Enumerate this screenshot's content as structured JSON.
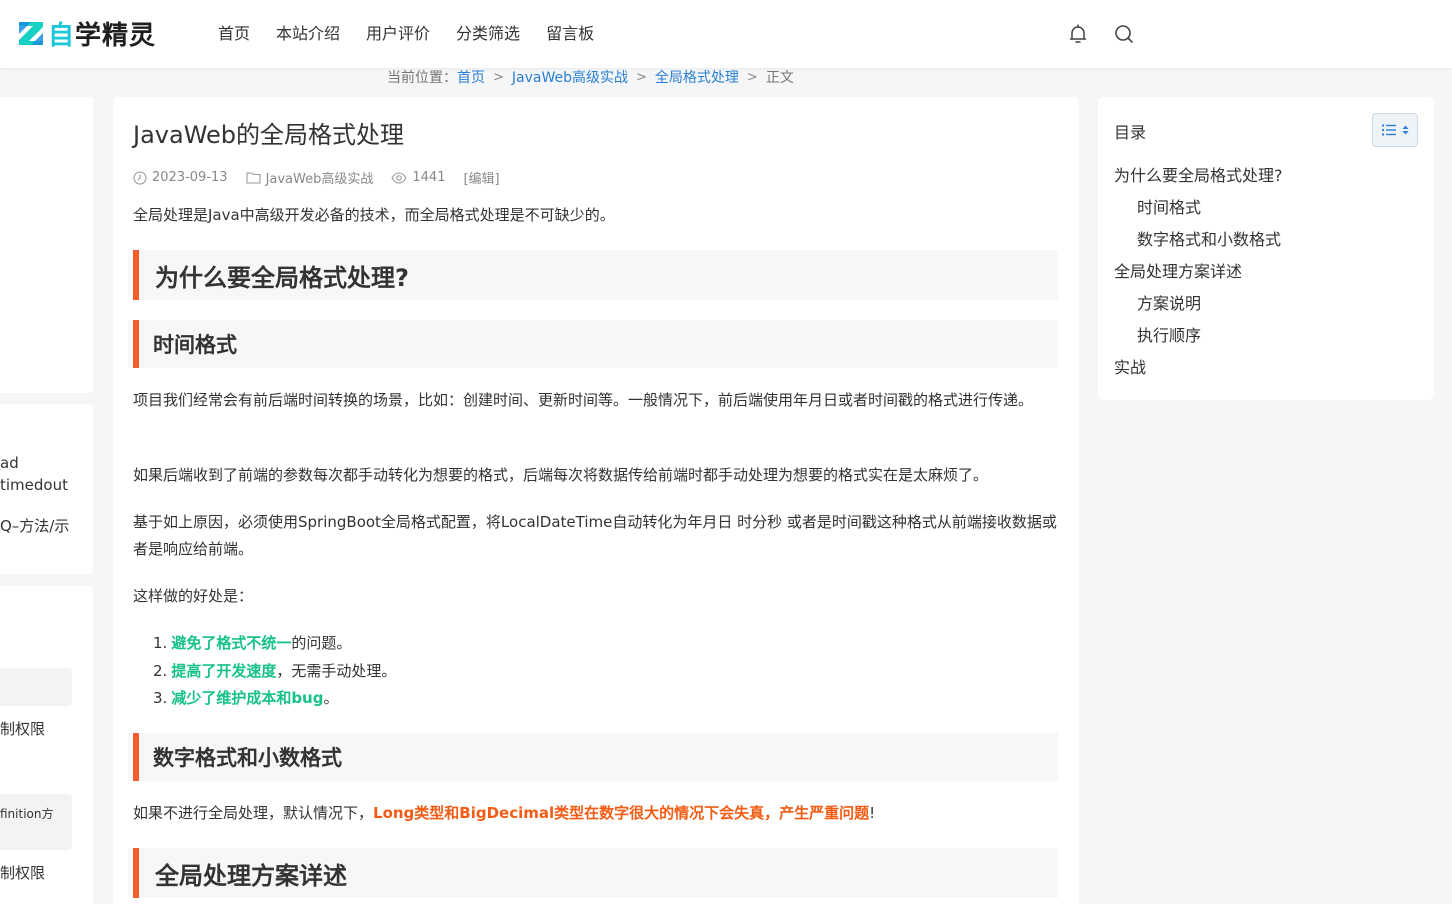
{
  "header": {
    "logo_first": "自",
    "logo_rest": "学精灵",
    "nav": [
      "首页",
      "本站介绍",
      "用户评价",
      "分类筛选",
      "留言板"
    ]
  },
  "breadcrumb": {
    "prefix": "当前位置：",
    "items": [
      "首页",
      "JavaWeb高级实战",
      "全局格式处理"
    ],
    "current": "正文"
  },
  "left_column": {
    "texts": [
      "ad",
      "timedout",
      "Q–方法/示",
      "制权限",
      "finition方",
      "制权限"
    ]
  },
  "article": {
    "title": "JavaWeb的全局格式处理",
    "meta": {
      "date": "2023-09-13",
      "category": "JavaWeb高级实战",
      "views": "1441",
      "edit": "[编辑]"
    },
    "intro": "全局处理是Java中高级开发必备的技术，而全局格式处理是不可缺少的。",
    "h_why": "为什么要全局格式处理?",
    "h_time": "时间格式",
    "p_time_1": "项目我们经常会有前后端时间转换的场景，比如：创建时间、更新时间等。一般情况下，前后端使用年月日或者时间戳的格式进行传递。",
    "p_time_2": "如果后端收到了前端的参数每次都手动转化为想要的格式，后端每次将数据传给前端时都手动处理为想要的格式实在是太麻烦了。",
    "p_time_3": "基于如上原因，必须使用SpringBoot全局格式配置，将LocalDateTime自动转化为年月日 时分秒 或者是时间戳这种格式从前端接收数据或者是响应给前端。",
    "p_benefit": "这样做的好处是：",
    "benefits": [
      {
        "num": "1.",
        "strong": "避免了格式不统一",
        "rest": "的问题。"
      },
      {
        "num": "2.",
        "strong": "提高了开发速度",
        "rest": "，无需手动处理。"
      },
      {
        "num": "3.",
        "strong": "减少了维护成本和bug",
        "rest": "。"
      }
    ],
    "h_number": "数字格式和小数格式",
    "p_number_pre": "如果不进行全局处理，默认情况下，",
    "p_number_strong": "Long类型和BigDecimal类型在数字很大的情况下会失真，产生严重问题",
    "p_number_post": "!",
    "h_scheme": "全局处理方案详述"
  },
  "toc": {
    "title": "目录",
    "items": [
      {
        "label": "为什么要全局格式处理?",
        "level": 1
      },
      {
        "label": "时间格式",
        "level": 2
      },
      {
        "label": "数字格式和小数格式",
        "level": 2
      },
      {
        "label": "全局处理方案详述",
        "level": 1
      },
      {
        "label": "方案说明",
        "level": 2
      },
      {
        "label": "执行顺序",
        "level": 2
      },
      {
        "label": "实战",
        "level": 1
      }
    ]
  },
  "colors": {
    "accent_green": "#17c287",
    "accent_orange": "#f25c14",
    "heading_bar": "#f45c2c",
    "link": "#2a7fd4",
    "logo_cyan": "#1ec7d8"
  },
  "icons": [
    "logo-mark-icon",
    "bell-icon",
    "search-icon",
    "chevron-right-icon",
    "clock-icon",
    "folder-icon",
    "eye-icon",
    "list-icon",
    "sort-icon"
  ]
}
